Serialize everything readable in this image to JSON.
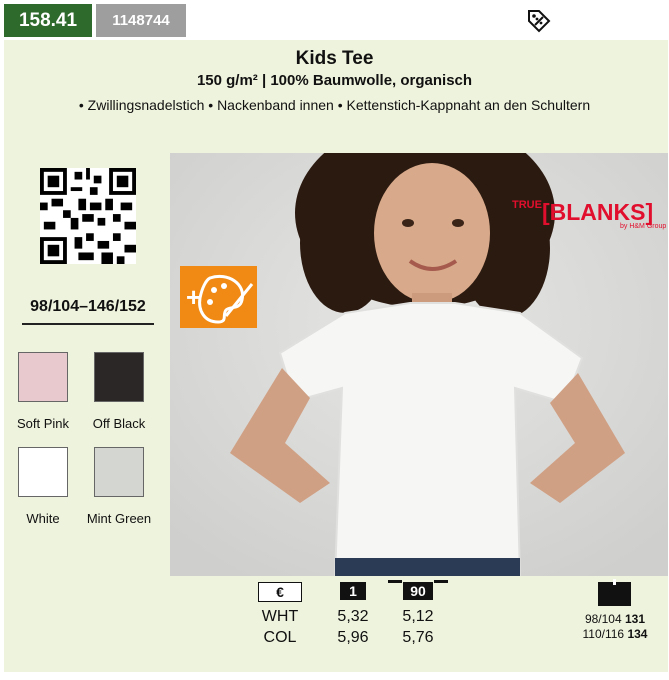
{
  "header": {
    "code_main": "158.41",
    "code_sub": "1148744",
    "icon": "discount-tag-icon"
  },
  "product": {
    "title": "Kids Tee",
    "subtitle": "150 g/m² | 100% Baumwolle, organisch",
    "features": "• Zwillingsnadelstich • Nackenband innen • Kettenstich-Kappnaht an den Schultern",
    "sizes": "98/104–146/152"
  },
  "colors": [
    {
      "label": "Soft Pink",
      "hex": "#e8c9cd"
    },
    {
      "label": "Off Black",
      "hex": "#2a2726"
    },
    {
      "label": "White",
      "hex": "#ffffff"
    },
    {
      "label": "Mint Green",
      "hex": "#d3d6d1"
    }
  ],
  "brand": {
    "prefix": "TRUE",
    "name": "[BLANKS]",
    "sub": "by H&M Group"
  },
  "pricing": {
    "currency_header": "€",
    "qty1_header": "1",
    "qty2_header": "90",
    "rows": [
      {
        "label": "WHT",
        "p1": "5,32",
        "p2": "5,12"
      },
      {
        "label": "COL",
        "p1": "5,96",
        "p2": "5,76"
      }
    ]
  },
  "packaging": {
    "lines": [
      {
        "size": "98/104",
        "qty": "131"
      },
      {
        "size": "110/116",
        "qty": "134"
      }
    ]
  }
}
